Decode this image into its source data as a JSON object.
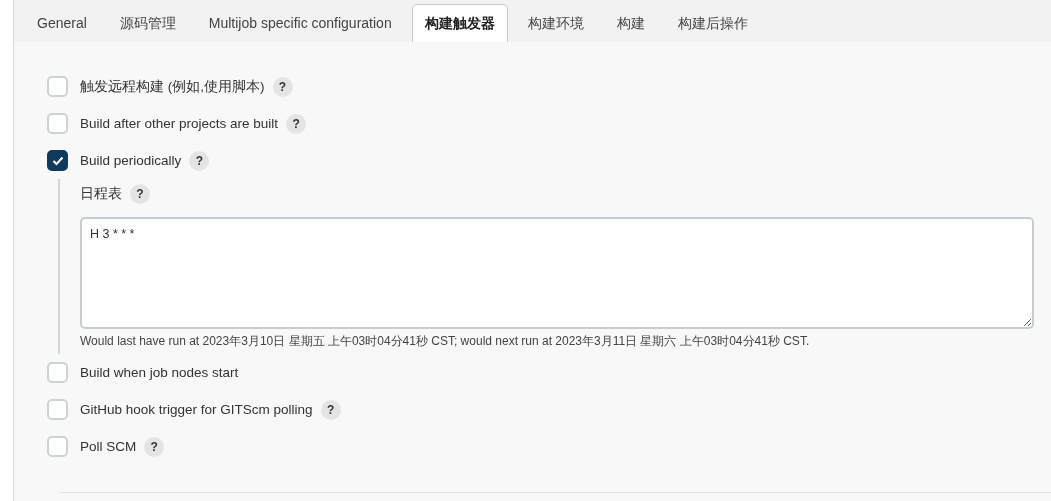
{
  "tabs": [
    {
      "label": "General",
      "selected": false
    },
    {
      "label": "源码管理",
      "selected": false
    },
    {
      "label": "Multijob specific configuration",
      "selected": false
    },
    {
      "label": "构建触发器",
      "selected": true
    },
    {
      "label": "构建环境",
      "selected": false
    },
    {
      "label": "构建",
      "selected": false
    },
    {
      "label": "构建后操作",
      "selected": false
    }
  ],
  "triggers": [
    {
      "label": "触发远程构建 (例如,使用脚本)",
      "checked": false,
      "help": "?"
    },
    {
      "label": "Build after other projects are built",
      "checked": false,
      "help": "?"
    },
    {
      "label": "Build periodically",
      "checked": true,
      "help": "?",
      "schedule": {
        "label": "日程表",
        "help": "?",
        "value": "H 3 * * *",
        "hint": "Would last have run at 2023年3月10日 星期五 上午03时04分41秒 CST; would next run at 2023年3月11日 星期六 上午03时04分41秒 CST."
      }
    },
    {
      "label": "Build when job nodes start",
      "checked": false
    },
    {
      "label": "GitHub hook trigger for GITScm polling",
      "checked": false,
      "help": "?"
    },
    {
      "label": "Poll SCM",
      "checked": false,
      "help": "?"
    }
  ]
}
